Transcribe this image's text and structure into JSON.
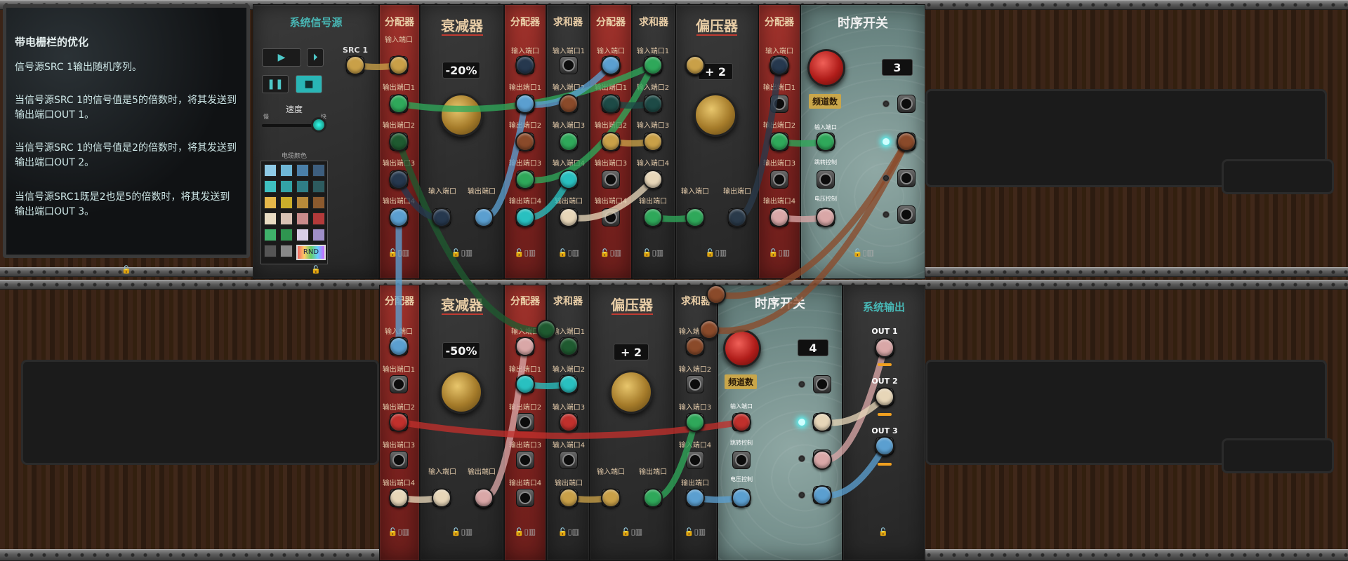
{
  "info": {
    "title": "带电栅栏的优化",
    "lines": [
      "信号源SRC 1输出随机序列。",
      "当信号源SRC 1的信号值是5的倍数时，将其发送到输出端口OUT 1。",
      "当信号源SRC 1的信号值是2的倍数时，将其发送到输出端口OUT 2。",
      "当信号源SRC1既是2也是5的倍数时，将其发送到输出端口OUT 3。"
    ]
  },
  "source": {
    "title": "系统信号源",
    "src_label": "SRC 1",
    "speed_label": "速度",
    "speed_left": "慢",
    "speed_right": "快",
    "cable_color_label": "电缆颜色",
    "rnd_label": "RND",
    "swatches": [
      "#8ecae6",
      "#6fb7d6",
      "#4a7fa8",
      "#3d5e7e",
      "#3fc0c0",
      "#33a3a6",
      "#2f7e86",
      "#2d5b5f",
      "#e6b84a",
      "#cbae2a",
      "#b88a3a",
      "#8c5a2e",
      "#e9dcc3",
      "#d8c2b4",
      "#c98b8b",
      "#b33a3a",
      "#3fb26a",
      "#2f9550",
      "#d9cfe6",
      "#9f8fc8",
      "#555555",
      "#888888"
    ]
  },
  "labels": {
    "splitter": "分配器",
    "attenuator": "衰减器",
    "summer": "求和器",
    "offset": "偏压器",
    "sequencer": "时序开关",
    "output": "系统输出",
    "in_port": "输入端口",
    "out_port": "输出端口",
    "in1": "输入端口1",
    "in2": "输入端口2",
    "in3": "输入端口3",
    "in4": "输入端口4",
    "out1": "输出端口1",
    "out2": "输出端口2",
    "out3": "输出端口3",
    "out4": "输出端口4",
    "channels": "频道数",
    "step_ctrl": "跳转控制",
    "volt_ctrl": "电压控制"
  },
  "values": {
    "atten_top": "-20%",
    "atten_bottom": "-50%",
    "offset_top": "+ 2",
    "offset_bottom": "+ 2",
    "seq_top": "3",
    "seq_bottom": "4"
  },
  "outputs": [
    "OUT 1",
    "OUT 2",
    "OUT 3"
  ],
  "colors": {
    "green": "#2fa85a",
    "gold": "#c9a048",
    "blue": "#5b9fd0",
    "red": "#c0302c",
    "pink": "#d9a7a7",
    "cream": "#e7d6b8",
    "teal": "#29c0c0",
    "darkgreen": "#1f5a30",
    "navy": "#26384e",
    "brown": "#8a4a2a",
    "darkteal": "#1d4a46",
    "slate": "#2a3a4a"
  }
}
